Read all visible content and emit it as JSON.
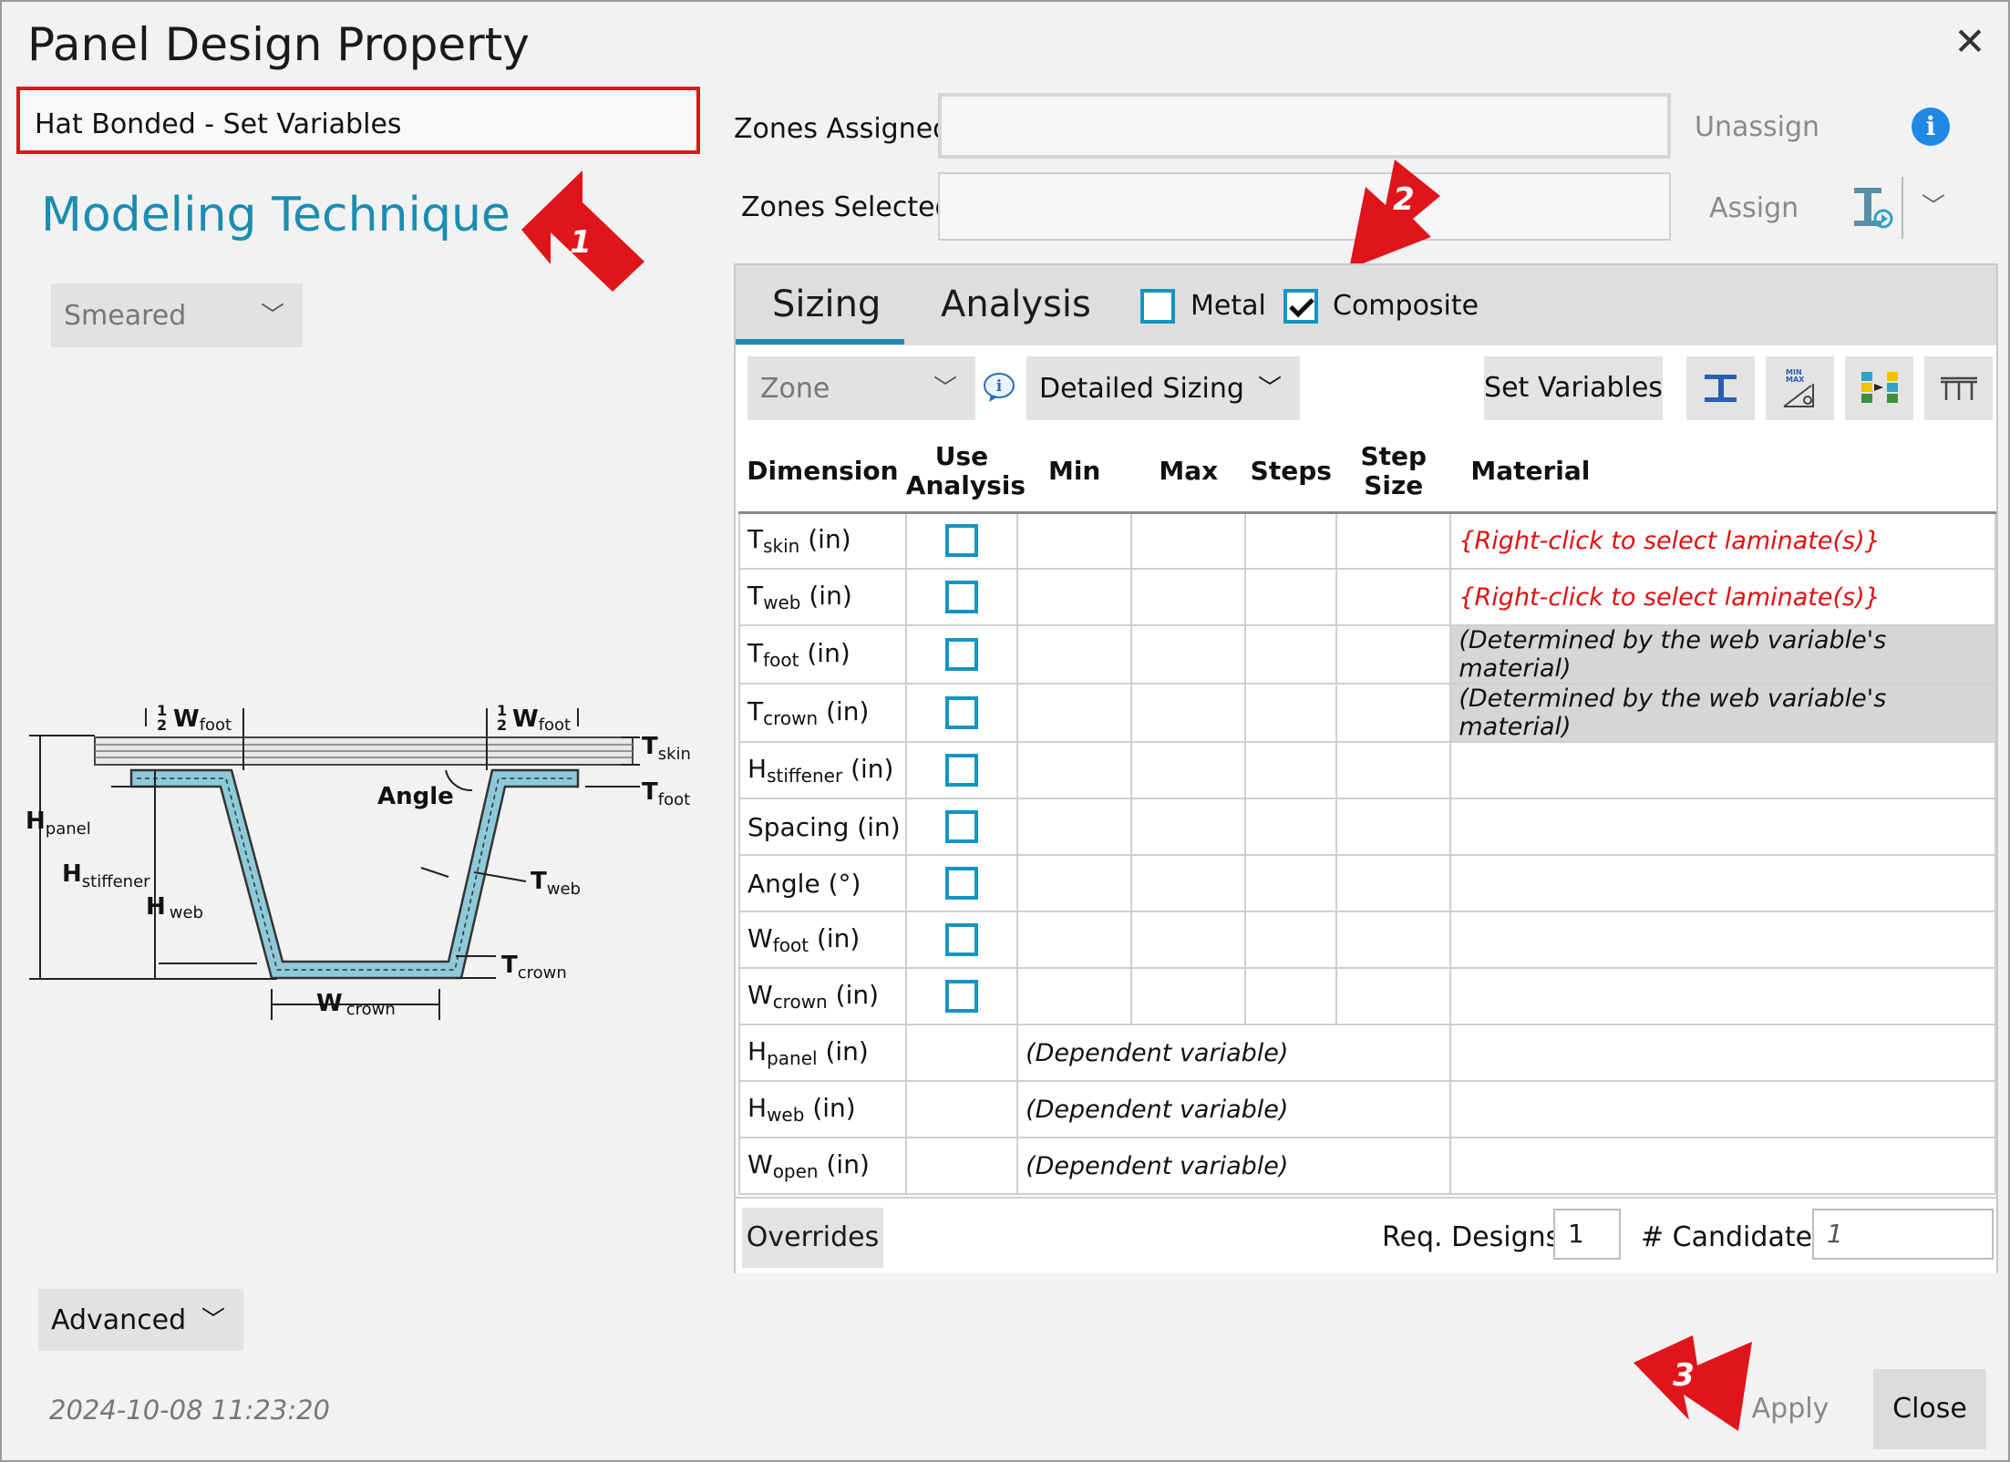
{
  "window": {
    "title": "Panel Design Property",
    "close_icon": "close-icon"
  },
  "property_name": "Hat Bonded - Set Variables",
  "left": {
    "heading": "Modeling Technique",
    "technique": "Smeared",
    "advanced": "Advanced",
    "timestamp": "2024-10-08 11:23:20"
  },
  "zones": {
    "assigned_label": "Zones Assigned:",
    "selected_label": "Zones Selected:",
    "unassign": "Unassign",
    "assign": "Assign"
  },
  "tabs": {
    "sizing": "Sizing",
    "analysis": "Analysis"
  },
  "material_type": {
    "metal": "Metal",
    "composite": "Composite",
    "metal_checked": false,
    "composite_checked": true
  },
  "toolbar": {
    "zone": "Zone",
    "sizing_mode": "Detailed Sizing",
    "set_variables": "Set Variables"
  },
  "table": {
    "headers": {
      "dimension": "Dimension",
      "use1": "Use",
      "use2": "Analysis",
      "min": "Min",
      "max": "Max",
      "steps": "Steps",
      "step1": "Step",
      "step2": "Size",
      "material": "Material"
    },
    "rows": [
      {
        "base": "T",
        "sub": "skin",
        "unit": " (in)",
        "material": "{Right-click to select laminate(s)}"
      },
      {
        "base": "T",
        "sub": "web",
        "unit": " (in)",
        "material": "{Right-click to select laminate(s)}"
      },
      {
        "base": "T",
        "sub": "foot",
        "unit": " (in)",
        "material": "(Determined by the web variable's material)"
      },
      {
        "base": "T",
        "sub": "crown",
        "unit": " (in)",
        "material": "(Determined by the web variable's material)"
      },
      {
        "base": "H",
        "sub": "stiffener",
        "unit": " (in)",
        "material": ""
      },
      {
        "base": "Spacing",
        "sub": "",
        "unit": " (in)",
        "material": ""
      },
      {
        "base": "Angle",
        "sub": "",
        "unit": " (°)",
        "material": ""
      },
      {
        "base": "W",
        "sub": "foot",
        "unit": " (in)",
        "material": ""
      },
      {
        "base": "W",
        "sub": "crown",
        "unit": " (in)",
        "material": ""
      }
    ],
    "dependent_rows": [
      {
        "base": "H",
        "sub": "panel",
        "unit": " (in)",
        "note": "(Dependent variable)"
      },
      {
        "base": "H",
        "sub": "web",
        "unit": " (in)",
        "note": "(Dependent variable)"
      },
      {
        "base": "W",
        "sub": "open",
        "unit": " (in)",
        "note": "(Dependent variable)"
      }
    ]
  },
  "footer": {
    "overrides": "Overrides",
    "req_designs_label": "Req. Designs",
    "req_designs": "1",
    "candidates_label": "# Candidates",
    "candidates": "1"
  },
  "buttons": {
    "apply": "Apply",
    "close": "Close"
  },
  "callouts": {
    "one": "1",
    "two": "2",
    "three": "3"
  },
  "diagram": {
    "half": "1",
    "half_den": "2",
    "w_foot": "W",
    "w_foot_sub": "foot",
    "t_skin": "T",
    "t_skin_sub": "skin",
    "t_foot": "T",
    "t_foot_sub": "foot",
    "angle": "Angle",
    "h_panel": "H",
    "h_panel_sub": "panel",
    "h_stiffener": "H",
    "h_stiffener_sub": "stiffener",
    "h_web": "H",
    "h_web_sub": "web",
    "t_web": "T",
    "t_web_sub": "web",
    "t_crown": "T",
    "t_crown_sub": "crown",
    "w_crown": "W",
    "w_crown_sub": "crown"
  },
  "colors": {
    "accent": "#1b8db0",
    "highlight": "#e0151b",
    "checkbox": "#1594c1",
    "info": "#1e88e5"
  }
}
